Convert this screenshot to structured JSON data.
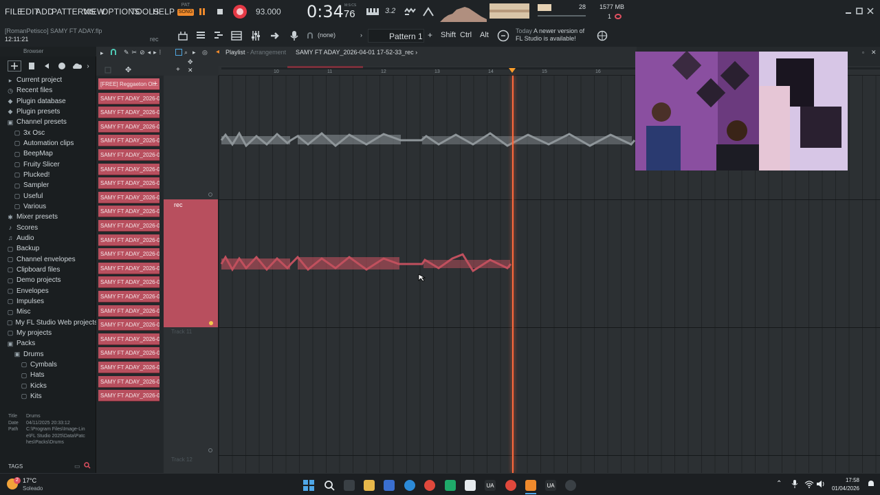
{
  "menu": [
    "FILE",
    "EDIT",
    "ADD",
    "PATTERNS",
    "VIEW",
    "OPTIONS",
    "TOOLS",
    "HELP"
  ],
  "transport": {
    "pat_label": "PAT",
    "song_label": "SONG",
    "tempo": "93.000",
    "time": "0:34",
    "time_sub": "76",
    "time_unit": "M:S:CS",
    "step_label": "3.2",
    "cpu": "28",
    "memory": "1577 MB",
    "voices": "1"
  },
  "project": {
    "file": "[RomanPetisco] SAMY FT ADAY.flp",
    "time": "12:11:21",
    "rec_label": "rec"
  },
  "toolbar": {
    "pattern_none": "(none)",
    "pattern": "Pattern 1",
    "plus": "+",
    "shift": "Shift",
    "ctrl": "Ctrl",
    "alt": "Alt",
    "news_day": "Today",
    "news_line1": "A newer version of",
    "news_line2": "FL Studio is available!"
  },
  "browser": {
    "title": "Browser",
    "items": [
      {
        "label": "Current project",
        "indent": 0,
        "icon": "current-project"
      },
      {
        "label": "Recent files",
        "indent": 0,
        "icon": "recent"
      },
      {
        "label": "Plugin database",
        "indent": 0,
        "icon": "plugin"
      },
      {
        "label": "Plugin presets",
        "indent": 0,
        "icon": "plugin"
      },
      {
        "label": "Channel presets",
        "indent": 0,
        "icon": "folder-open"
      },
      {
        "label": "3x Osc",
        "indent": 1,
        "icon": "folder"
      },
      {
        "label": "Automation clips",
        "indent": 1,
        "icon": "folder"
      },
      {
        "label": "BeepMap",
        "indent": 1,
        "icon": "folder"
      },
      {
        "label": "Fruity Slicer",
        "indent": 1,
        "icon": "folder"
      },
      {
        "label": "Plucked!",
        "indent": 1,
        "icon": "folder"
      },
      {
        "label": "Sampler",
        "indent": 1,
        "icon": "folder"
      },
      {
        "label": "Useful",
        "indent": 1,
        "icon": "folder"
      },
      {
        "label": "Various",
        "indent": 1,
        "icon": "folder"
      },
      {
        "label": "Mixer presets",
        "indent": 0,
        "icon": "mixer"
      },
      {
        "label": "Scores",
        "indent": 0,
        "icon": "note"
      },
      {
        "label": "Audio",
        "indent": 0,
        "icon": "audio"
      },
      {
        "label": "Backup",
        "indent": 0,
        "icon": "folder"
      },
      {
        "label": "Channel envelopes",
        "indent": 0,
        "icon": "folder"
      },
      {
        "label": "Clipboard files",
        "indent": 0,
        "icon": "folder"
      },
      {
        "label": "Demo projects",
        "indent": 0,
        "icon": "folder"
      },
      {
        "label": "Envelopes",
        "indent": 0,
        "icon": "folder"
      },
      {
        "label": "Impulses",
        "indent": 0,
        "icon": "folder"
      },
      {
        "label": "Misc",
        "indent": 0,
        "icon": "folder"
      },
      {
        "label": "My FL Studio Web projects",
        "indent": 0,
        "icon": "folder"
      },
      {
        "label": "My projects",
        "indent": 0,
        "icon": "folder"
      },
      {
        "label": "Packs",
        "indent": 0,
        "icon": "folder-open"
      },
      {
        "label": "Drums",
        "indent": 1,
        "icon": "folder-open"
      },
      {
        "label": "Cymbals",
        "indent": 2,
        "icon": "folder"
      },
      {
        "label": "Hats",
        "indent": 2,
        "icon": "folder"
      },
      {
        "label": "Kicks",
        "indent": 2,
        "icon": "folder"
      },
      {
        "label": "Kits",
        "indent": 2,
        "icon": "folder"
      }
    ],
    "info": {
      "title_label": "Title",
      "title_value": "Drums",
      "date_label": "Date",
      "date_value": "04/11/2025 20:33:12",
      "path_label": "Path",
      "path_lines": [
        "C:\\Program Files\\Image-Lin",
        "e\\FL Studio 2025\\Data\\Patc",
        "hes\\Packs\\Drums"
      ]
    },
    "tags_label": "TAGS"
  },
  "playlist": {
    "title": "Playlist",
    "sep": "-",
    "view": "Arrangement",
    "arrangement": "SAMY FT ADAY_2026-04-01 17-52-33_rec",
    "bar_numbers": [
      "10",
      "11",
      "12",
      "13",
      "14",
      "15",
      "16"
    ],
    "rec_clip_label": "rec",
    "track_labels": [
      "Track 11",
      "Track 12"
    ]
  },
  "channels": {
    "items": [
      "[FREE] Reggaeton Ol...",
      "SAMY FT ADAY_2026-04-...",
      "SAMY FT ADAY_2026-04-...",
      "SAMY FT ADAY_2026-04-...",
      "SAMY FT ADAY_2026-04-...",
      "SAMY FT ADAY_2026-04-...",
      "SAMY FT ADAY_2026-04-...",
      "SAMY FT ADAY_2026-04-...",
      "SAMY FT ADAY_2026-04-...",
      "SAMY FT ADAY_2026-04-...",
      "SAMY FT ADAY_2026-04-...",
      "SAMY FT ADAY_2026-04-...",
      "SAMY FT ADAY_2026-04-...",
      "SAMY FT ADAY_2026-04-...",
      "SAMY FT ADAY_2026-04-...",
      "SAMY FT ADAY_2026-04-...",
      "SAMY FT ADAY_2026-04-...",
      "SAMY FT ADAY_2026-04-...",
      "SAMY FT ADAY_2026-04-...",
      "SAMY FT ADAY_2026-04-...",
      "SAMY FT ADAY_2026-04-...",
      "SAMY FT ADAY_2026-04-...",
      "SAMY FT ADAY_2026-04-..."
    ],
    "add_button": "+"
  },
  "taskbar": {
    "weather_temp": "17°C",
    "weather_desc": "Soleado",
    "weather_badge": "2",
    "time": "17:58",
    "date": "01/04/2026"
  },
  "colors": {
    "accent": "#e05060",
    "clip_red": "#b84f5e",
    "waveform_gray": "#8e9599",
    "waveform_red": "#c0505e",
    "playhead": "#ff6a3d",
    "record": "#e53945",
    "song_mode": "#f08a2c"
  }
}
